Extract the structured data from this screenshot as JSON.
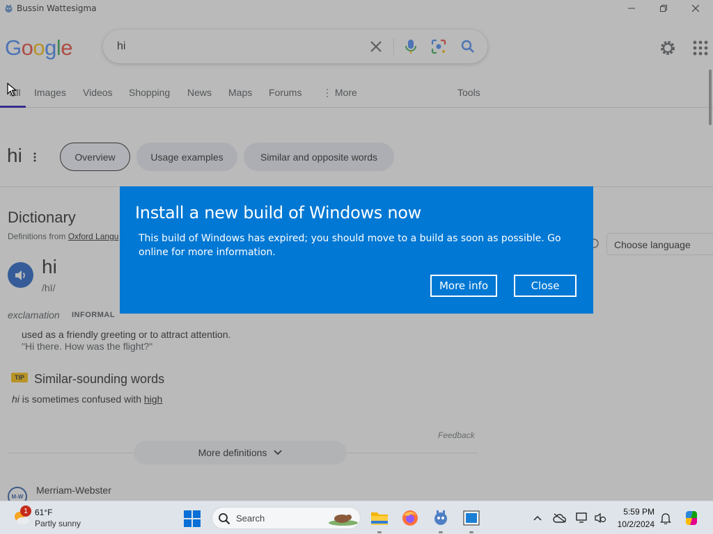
{
  "window": {
    "title": "Bussin Wattesigma"
  },
  "google": {
    "logo_letters": [
      {
        "ch": "G",
        "color": "#4285f4"
      },
      {
        "ch": "o",
        "color": "#ea4335"
      },
      {
        "ch": "o",
        "color": "#fbbc05"
      },
      {
        "ch": "g",
        "color": "#4285f4"
      },
      {
        "ch": "l",
        "color": "#34a853"
      },
      {
        "ch": "e",
        "color": "#ea4335"
      }
    ],
    "query": "hi"
  },
  "tabs": [
    {
      "label": "All"
    },
    {
      "label": "Images"
    },
    {
      "label": "Videos"
    },
    {
      "label": "Shopping"
    },
    {
      "label": "News"
    },
    {
      "label": "Maps"
    },
    {
      "label": "Forums"
    },
    {
      "label": "More"
    },
    {
      "label": "Tools"
    }
  ],
  "word": {
    "title": "hi",
    "chips": [
      "Overview",
      "Usage examples",
      "Similar and opposite words"
    ]
  },
  "dictionary": {
    "heading": "Dictionary",
    "source_prefix": "Definitions from ",
    "source_link": "Oxford Langu",
    "choose_language": "Choose language",
    "headword": "hi",
    "pronunciation": "/hī/",
    "part_of_speech": "exclamation",
    "register": "INFORMAL",
    "definition": "used as a friendly greeting or to attract attention.",
    "example": "\"Hi there. How was the flight?\"",
    "tip_badge": "TIP",
    "tip_heading": "Similar-sounding words",
    "tip_word": "hi",
    "tip_middle": " is sometimes confused with ",
    "tip_link": "high",
    "feedback": "Feedback",
    "more_definitions": "More definitions",
    "next_source": "Merriam-Webster",
    "next_source_logo": "M-W"
  },
  "dialog": {
    "title": "Install a new build of Windows now",
    "body": "This build of Windows has expired; you should move to a build as soon as possible. Go online for more information.",
    "more_info": "More info",
    "close": "Close",
    "background": "#0078d4"
  },
  "taskbar": {
    "weather_temp": "61°F",
    "weather_desc": "Partly sunny",
    "weather_badge": "1",
    "search_label": "Search",
    "time": "5:59 PM",
    "date": "10/2/2024"
  }
}
